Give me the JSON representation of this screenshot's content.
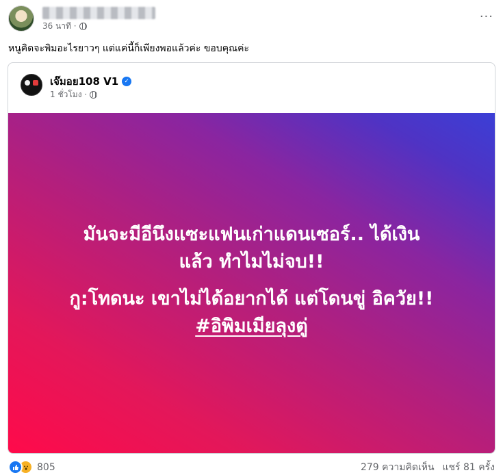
{
  "post": {
    "time": "36 นาที ·",
    "caption": "หนูคิดจะพิมอะไรยาวๆ แต่แค่นี้ก็เพียงพอแล้วค่ะ ขอบคุณค่ะ",
    "more": "···"
  },
  "shared": {
    "page_name": "เจ๊มอย108 V1",
    "verified": "✓",
    "time": "1 ชั่วโมง ·",
    "image_text": {
      "line1": "มันจะมีอีนึงแซะแฟนเก่าแดนเซอร์.. ได้เงิน",
      "line2": "แล้ว ทำไมไม่จบ!!",
      "line3": "กู:โทดนะ เขาไม่ได้อยากได้ แต่โดนขู่ อิควัย!!",
      "hashtag": "#อิพิมเมียลุงตู่"
    },
    "colors": {
      "gradient_start": "#ff0a4a",
      "gradient_end": "#3b3fd6"
    }
  },
  "footer": {
    "reaction_icons": [
      "like-icon",
      "wow-icon"
    ],
    "reaction_count": "805",
    "comments": "279 ความคิดเห็น",
    "shares": "แชร์ 81 ครั้ง"
  }
}
